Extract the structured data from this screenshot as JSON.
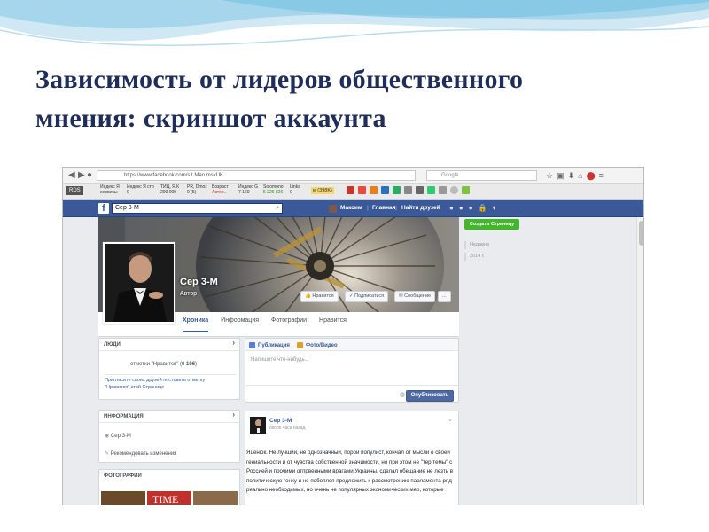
{
  "slide": {
    "title_line1": "Зависимость от лидеров общественного",
    "title_line2": "мнения: скриншот аккаунта"
  },
  "browser": {
    "url": "https://www.facebook.com/s.t.Man.mskUK",
    "search_placeholder": "Google",
    "toolbar": {
      "rds": "RDS",
      "yandex_index_label": "Индекс Я",
      "yandex_index_value": "сервисы",
      "yandex_pages_label": "Индекс Я стр",
      "yandex_pages_value": "0",
      "tic_label": "ТИЦ, Я.К",
      "tic_value": "200 000",
      "pr_label": "PR, Dmoz",
      "pr_value": "0 (5)",
      "age_label": "Возраст",
      "age_value": "Автор..",
      "index_g_label": "Индекс G",
      "index_g_value": "7 160",
      "solomono_label": "Solomono",
      "solomono_value": "5 226 826",
      "linkpad_label": "Links",
      "linkpad_value": "0",
      "m_value": "м (398K)"
    }
  },
  "facebook": {
    "logo": "f",
    "search_value": "Сер 3-М",
    "user_name": "Максим",
    "nav_home": "Главная",
    "nav_find_friends": "Найти друзей",
    "nav_sep": "|",
    "profile_name": "Сер 3-М",
    "profile_type": "Автор",
    "btn_like": "Нравится",
    "btn_subscribe": "Подписаться",
    "btn_message": "Сообщение",
    "btn_more": "...",
    "tabs": [
      "Хроника",
      "Информация",
      "Фотографии",
      "Нравится"
    ],
    "create_page": "Создать Страницу",
    "timeline": [
      "Недавно",
      "2014 г."
    ],
    "people": {
      "header": "ЛЮДИ",
      "likes_text": "отметки \"Нравится\"",
      "likes_count": "6 106",
      "invite_text_1": "Пригласите своих друзей поставить отметку",
      "invite_text_2": "\"Нравится\" этой Странице"
    },
    "info": {
      "header": "ИНФОРМАЦИЯ",
      "name": "Сер 3-М",
      "recommend": "Рекомендовать изменения"
    },
    "photos_header": "ФОТОГРАФИИ",
    "composer": {
      "publication": "Публикация",
      "photo_video": "Фото/Видео",
      "placeholder": "Напишите что-нибудь...",
      "publish": "Опубликовать"
    },
    "post": {
      "author": "Сер 3-М",
      "time": "около часа назад",
      "text": "Яценюк. Не лучший, не однозначный, порой популист, кончал от мысли о своей гениальности и от чувства собственной значимости, но при этом не \"тер темы\" с Россией и прочими отпрвенными врагами Украины, сделал обещание не лезть в политическую гонку и не побоялся предложить к рассмотрению парламента ряд реально необходимых, но очень не популярных экономических мер, которые"
    }
  },
  "colors": {
    "title": "#1f2d5a",
    "facebook_blue": "#3b5998",
    "create_green": "#42b72a",
    "publish_button": "#4e69a2"
  }
}
